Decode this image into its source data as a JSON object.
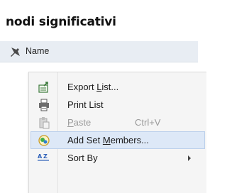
{
  "header": {
    "title": "nodi significativi"
  },
  "column_header": {
    "label": "Name",
    "icon": "pin-icon"
  },
  "context_menu": {
    "items": [
      {
        "label_before": "Export ",
        "mnemonic": "L",
        "label_after": "ist...",
        "icon": "export-list-icon",
        "enabled": true
      },
      {
        "label_before": "Print List",
        "mnemonic": "",
        "label_after": "",
        "icon": "printer-icon",
        "enabled": true
      },
      {
        "label_before": "",
        "mnemonic": "P",
        "label_after": "aste",
        "shortcut": "Ctrl+V",
        "icon": "paste-icon",
        "enabled": false
      },
      {
        "label_before": "Add Set ",
        "mnemonic": "M",
        "label_after": "embers...",
        "icon": "add-set-members-icon",
        "enabled": true,
        "highlighted": true
      },
      {
        "label_before": "Sort By",
        "mnemonic": "",
        "label_after": "",
        "icon": "sort-az-icon",
        "enabled": true,
        "has_submenu": true
      }
    ]
  },
  "colors": {
    "highlight": "#dde8f7",
    "header_bg": "#e8edf3",
    "accent": "#1e6fd9"
  }
}
